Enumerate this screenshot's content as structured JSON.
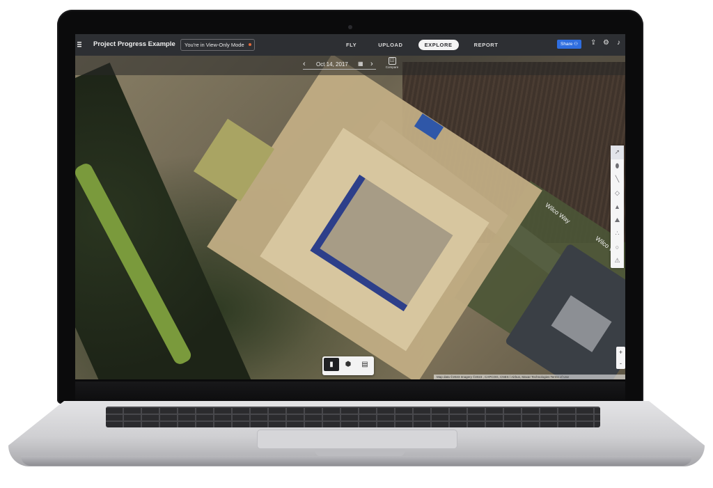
{
  "app": {
    "title": "Project Progress Example",
    "view_only_badge": "You're in View-Only Mode",
    "badge_color": "#e46a3b"
  },
  "nav": {
    "tabs": [
      {
        "label": "FLY"
      },
      {
        "label": "UPLOAD"
      },
      {
        "label": "EXPLORE",
        "active": true
      },
      {
        "label": "REPORT"
      }
    ]
  },
  "header": {
    "share_label": "Share",
    "share_color": "#2f6ee0",
    "icons": [
      "upload-icon",
      "gear-icon",
      "bell-icon"
    ]
  },
  "date_selector": {
    "date": "Oct 14, 2017",
    "compare_label": "Compare"
  },
  "tools": [
    "pointer-icon",
    "marker-icon",
    "line-icon",
    "area-icon",
    "volume-icon",
    "elevation-icon",
    "points-icon",
    "circle-icon",
    "warning-icon"
  ],
  "zoom": {
    "in_label": "+",
    "out_label": "-"
  },
  "view_modes": [
    {
      "icon": "map-2d-icon",
      "active": true
    },
    {
      "icon": "cube-3d-icon",
      "active": false
    },
    {
      "icon": "layout-icon",
      "active": false
    }
  ],
  "map": {
    "road_label": "Wilco Way",
    "road_label_2": "Wilco Way",
    "attribution": "Map data ©2023 Imagery ©2023 , CAPCOG, CNES / Airbus, Maxar Technologies   Terms of Use"
  }
}
